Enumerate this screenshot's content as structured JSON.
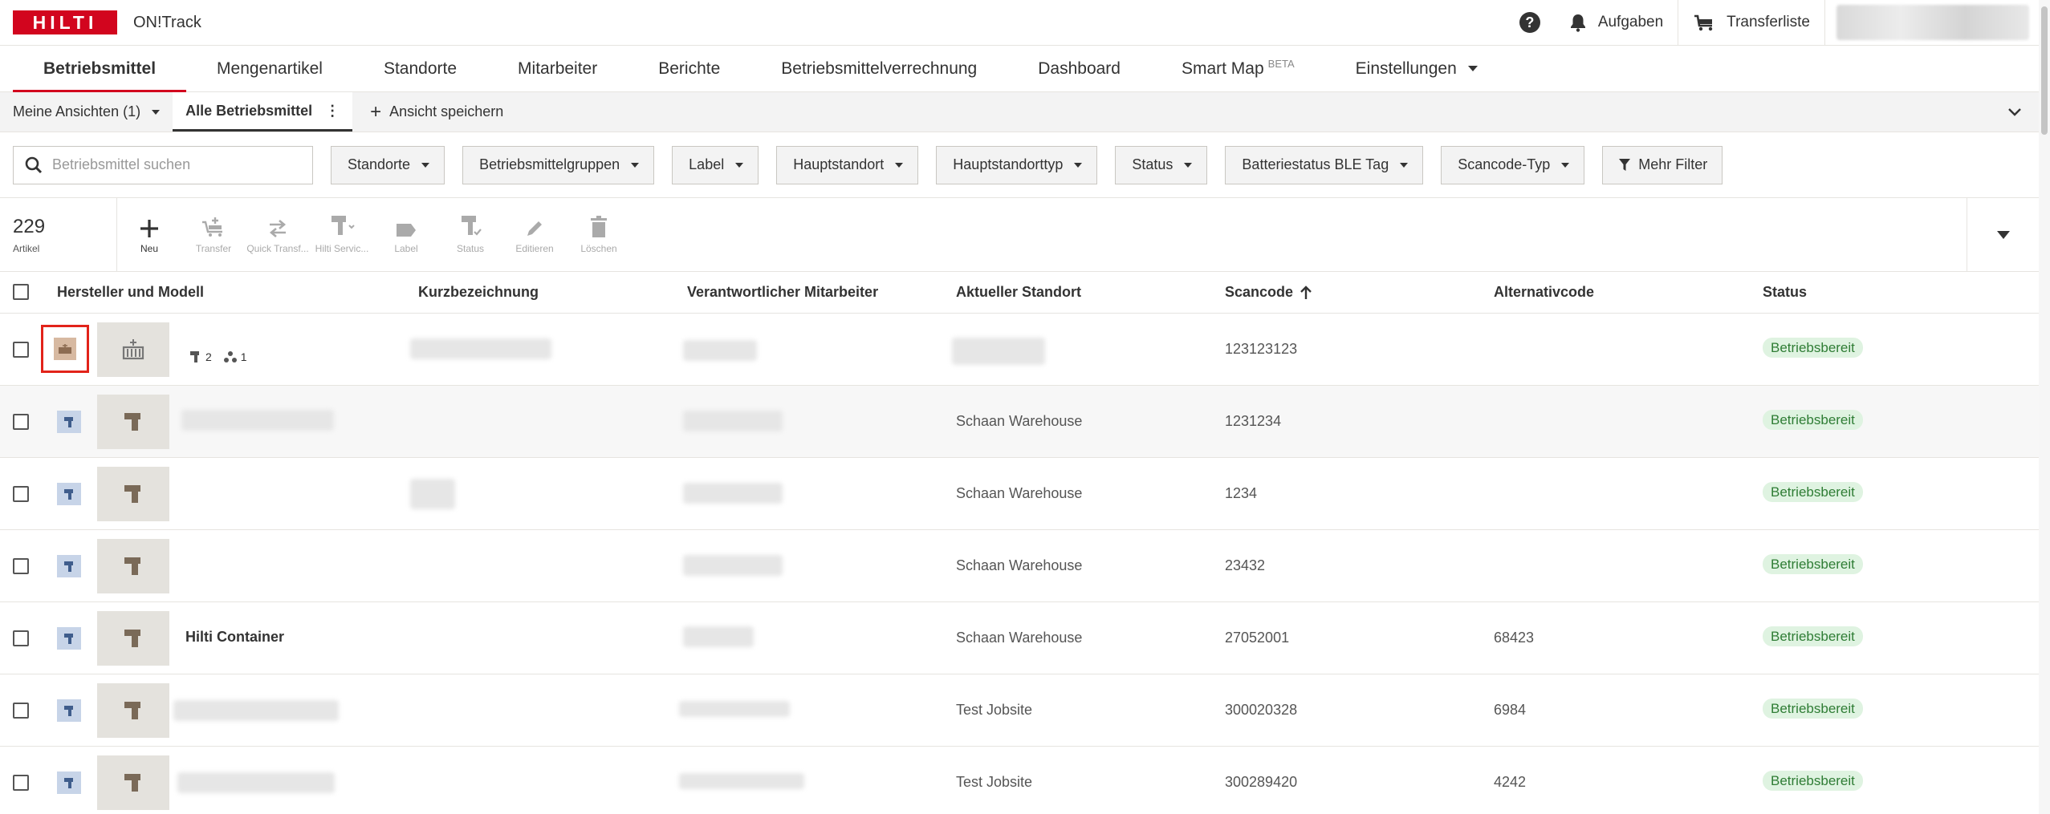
{
  "header": {
    "logo_text": "HILTI",
    "app_title": "ON!Track",
    "tasks_label": "Aufgaben",
    "transfer_list_label": "Transferliste"
  },
  "nav": {
    "items": [
      {
        "label": "Betriebsmittel"
      },
      {
        "label": "Mengenartikel"
      },
      {
        "label": "Standorte"
      },
      {
        "label": "Mitarbeiter"
      },
      {
        "label": "Berichte"
      },
      {
        "label": "Betriebsmittelverrechnung"
      },
      {
        "label": "Dashboard"
      },
      {
        "label": "Smart Map",
        "badge": "BETA"
      },
      {
        "label": "Einstellungen"
      }
    ]
  },
  "views": {
    "my_views": "Meine Ansichten (1)",
    "current": "Alle Betriebsmittel",
    "save_view": "Ansicht speichern"
  },
  "filters": {
    "search_placeholder": "Betriebsmittel suchen",
    "items": [
      "Standorte",
      "Betriebsmittelgruppen",
      "Label",
      "Hauptstandort",
      "Hauptstandorttyp",
      "Status",
      "Batteriestatus BLE Tag",
      "Scancode-Typ"
    ],
    "more": "Mehr Filter"
  },
  "actions": {
    "count": "229",
    "count_label": "Artikel",
    "items": [
      {
        "label": "Neu",
        "icon": "plus-icon"
      },
      {
        "label": "Transfer",
        "icon": "transfer-cart-icon"
      },
      {
        "label": "Quick Transf...",
        "icon": "quick-transfer-icon"
      },
      {
        "label": "Hilti Servic...",
        "icon": "hilti-service-icon"
      },
      {
        "label": "Label",
        "icon": "label-icon"
      },
      {
        "label": "Status",
        "icon": "status-icon"
      },
      {
        "label": "Editieren",
        "icon": "pencil-icon"
      },
      {
        "label": "Löschen",
        "icon": "trash-icon"
      }
    ]
  },
  "table": {
    "columns": [
      "Hersteller und Modell",
      "Kurzbezeichnung",
      "Verantwortlicher Mitarbeiter",
      "Aktueller Standort",
      "Scancode",
      "Alternativcode",
      "Status"
    ],
    "rows": [
      {
        "model": "",
        "tools_count": "2",
        "groups_count": "1",
        "location": "",
        "scancode": "123123123",
        "altcode": "",
        "status": "Betriebsbereit"
      },
      {
        "model": "",
        "location": "Schaan Warehouse",
        "scancode": "1231234",
        "altcode": "",
        "status": "Betriebsbereit"
      },
      {
        "model": "",
        "location": "Schaan Warehouse",
        "scancode": "1234",
        "altcode": "",
        "status": "Betriebsbereit"
      },
      {
        "model": "",
        "location": "Schaan Warehouse",
        "scancode": "23432",
        "altcode": "",
        "status": "Betriebsbereit"
      },
      {
        "model": "Hilti Container",
        "location": "Schaan Warehouse",
        "scancode": "27052001",
        "altcode": "68423",
        "status": "Betriebsbereit"
      },
      {
        "model": "",
        "location": "Test Jobsite",
        "scancode": "300020328",
        "altcode": "6984",
        "status": "Betriebsbereit"
      },
      {
        "model": "",
        "location": "Test Jobsite",
        "scancode": "300289420",
        "altcode": "4242",
        "status": "Betriebsbereit"
      }
    ]
  },
  "colors": {
    "brand": "#d2051e",
    "status_bg": "#dff3e1",
    "status_text": "#2f7d35",
    "highlight": "#e2231a"
  }
}
